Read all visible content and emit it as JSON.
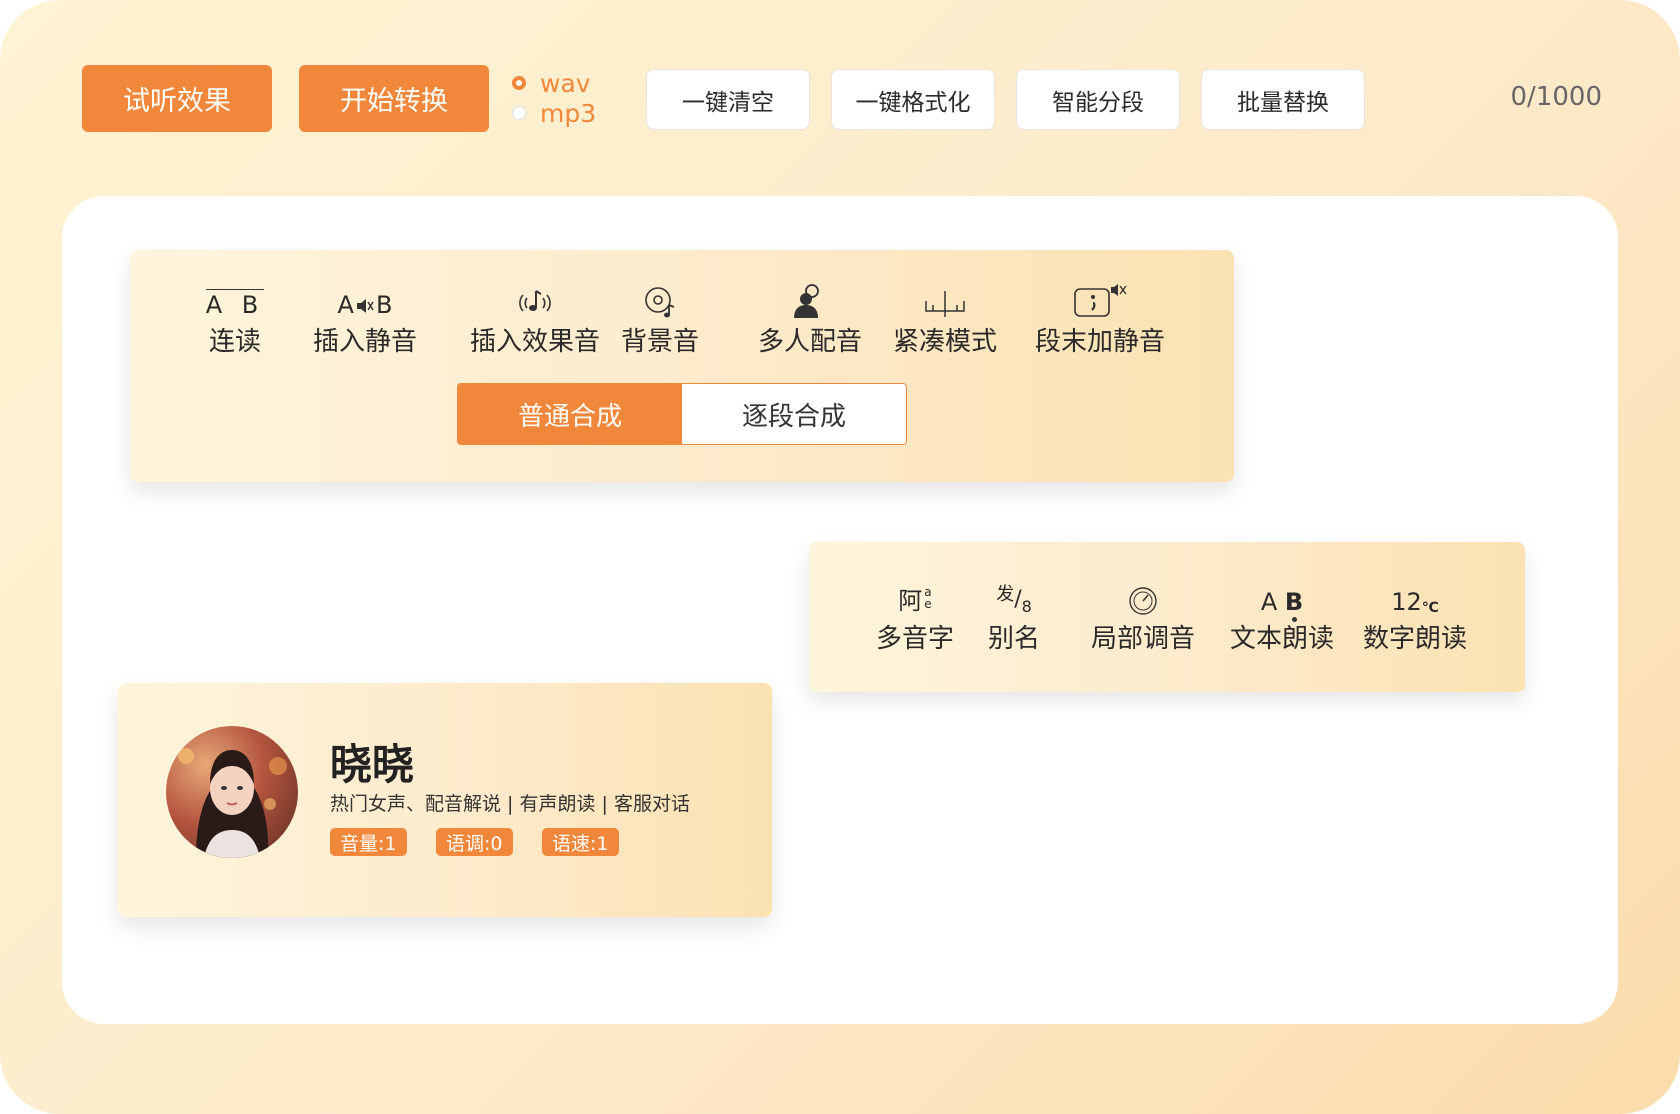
{
  "toolbar": {
    "preview_label": "试听效果",
    "convert_label": "开始转换",
    "formats": [
      {
        "label": "wav",
        "selected": true
      },
      {
        "label": "mp3",
        "selected": false
      }
    ],
    "buttons": [
      "一键清空",
      "一键格式化",
      "智能分段",
      "批量替换"
    ],
    "counter": "0/1000"
  },
  "tools_top": {
    "items": [
      {
        "icon": "ab-overline-icon",
        "label": "连读",
        "icon_text": "A B"
      },
      {
        "icon": "insert-silence-icon",
        "label": "插入静音",
        "icon_text": "A"
      },
      {
        "icon": "music-note-icon",
        "label": "插入效果音"
      },
      {
        "icon": "background-music-icon",
        "label": "背景音"
      },
      {
        "icon": "multi-person-icon",
        "label": "多人配音"
      },
      {
        "icon": "compact-mode-icon",
        "label": "紧凑模式"
      },
      {
        "icon": "paragraph-silence-icon",
        "label": "段末加静音"
      }
    ],
    "synth_tabs": [
      {
        "label": "普通合成",
        "active": true
      },
      {
        "label": "逐段合成",
        "active": false
      }
    ]
  },
  "tools_right": {
    "items": [
      {
        "icon": "polyphone-icon",
        "label": "多音字",
        "icon_text": "阿"
      },
      {
        "icon": "alias-icon",
        "label": "别名",
        "icon_text": "发"
      },
      {
        "icon": "gauge-icon",
        "label": "局部调音"
      },
      {
        "icon": "text-read-icon",
        "label": "文本朗读",
        "icon_text": "A B"
      },
      {
        "icon": "number-read-icon",
        "label": "数字朗读",
        "icon_text": "12"
      }
    ]
  },
  "voice": {
    "name": "晓晓",
    "description": "热门女声、配音解说 | 有声朗读 | 客服对话",
    "tags": [
      "音量:1",
      "语调:0",
      "语速:1"
    ]
  },
  "colors": {
    "accent": "#f0873a"
  }
}
